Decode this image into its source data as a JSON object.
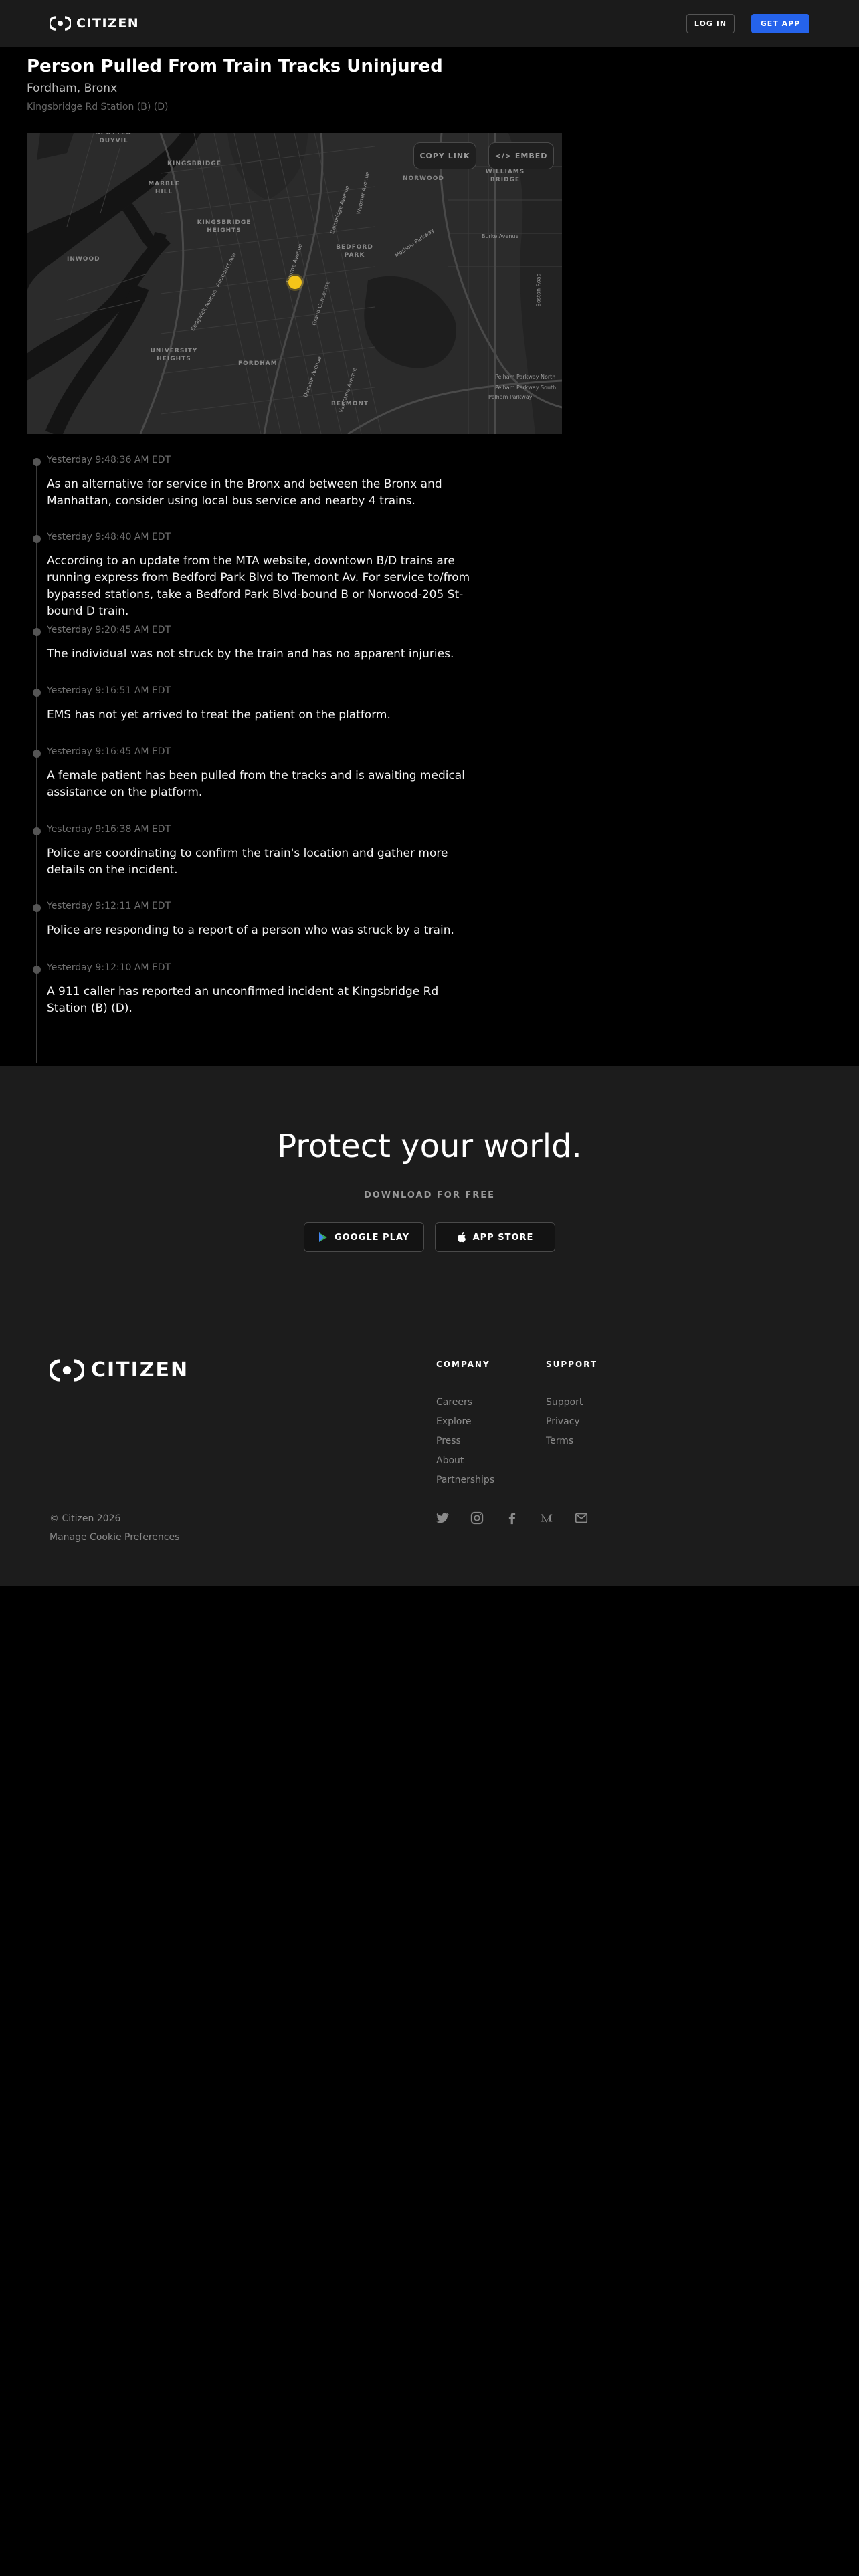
{
  "header": {
    "brand": "CITIZEN",
    "login_label": "LOG IN",
    "get_app_label": "GET APP"
  },
  "incident": {
    "title": "Person Pulled From Train Tracks Uninjured",
    "neighborhood": "Fordham, Bronx",
    "location": "Kingsbridge Rd Station (B) (D)"
  },
  "map": {
    "copy_link_label": "COPY LINK",
    "embed_label": "</> EMBED",
    "pin_color": "#f5c518",
    "areas": [
      "SPUYTEN DUYVIL",
      "KINGSBRIDGE",
      "MARBLE HILL",
      "KINGSBRIDGE HEIGHTS",
      "NORWOOD",
      "WILLIAMS BRIDGE",
      "BEDFORD PARK",
      "INWOOD",
      "UNIVERSITY HEIGHTS",
      "FORDHAM",
      "BELMONT"
    ],
    "streets": [
      "Jerome Avenue",
      "Grand Concourse",
      "Webster Avenue",
      "Bainbridge Avenue",
      "Mosholu Parkway",
      "Decatur Avenue",
      "Valentine Avenue",
      "Aqueduct Ave",
      "Sedgwick Avenue",
      "Burke Avenue",
      "Boston Road",
      "Pelham Parkway",
      "Pelham Parkway North",
      "Pelham Parkway South"
    ]
  },
  "timeline": [
    {
      "time": "Yesterday 9:48:36 AM EDT",
      "text": "As an alternative for service in the Bronx and between the Bronx and Manhattan, consider using local bus service and nearby 4 trains."
    },
    {
      "time": "Yesterday 9:48:40 AM EDT",
      "text": "According to an update from the MTA website, downtown B/D trains are running express from Bedford Park Blvd to Tremont Av. For service to/from bypassed stations, take a Bedford Park Blvd-bound B or Norwood-205 St-bound D train."
    },
    {
      "time": "Yesterday 9:20:45 AM EDT",
      "text": "The individual was not struck by the train and has no apparent injuries."
    },
    {
      "time": "Yesterday 9:16:51 AM EDT",
      "text": "EMS has not yet arrived to treat the patient on the platform."
    },
    {
      "time": "Yesterday 9:16:45 AM EDT",
      "text": "A female patient has been pulled from the tracks and is awaiting medical assistance on the platform."
    },
    {
      "time": "Yesterday 9:16:38 AM EDT",
      "text": "Police are coordinating to confirm the train's location and gather more details on the incident."
    },
    {
      "time": "Yesterday 9:12:11 AM EDT",
      "text": "Police are responding to a report of a person who was struck by a train."
    },
    {
      "time": "Yesterday 9:12:10 AM EDT",
      "text": "A 911 caller has reported an unconfirmed incident at Kingsbridge Rd Station (B) (D)."
    }
  ],
  "promo": {
    "title": "Protect your world.",
    "subtitle": "DOWNLOAD FOR FREE",
    "google_play_label": "GOOGLE PLAY",
    "app_store_label": "APP STORE"
  },
  "footer": {
    "brand": "CITIZEN",
    "company_heading": "COMPANY",
    "company_links": [
      "Careers",
      "Explore",
      "Press",
      "About",
      "Partnerships"
    ],
    "support_heading": "SUPPORT",
    "support_links": [
      "Support",
      "Privacy",
      "Terms"
    ],
    "copyright": "© Citizen 2026",
    "cookie_label": "Manage Cookie Preferences",
    "socials": [
      "twitter-icon",
      "instagram-icon",
      "facebook-icon",
      "medium-icon",
      "mail-icon"
    ]
  },
  "colors": {
    "accent": "#2563eb",
    "background": "#000000",
    "panel": "#1c1c1c"
  }
}
